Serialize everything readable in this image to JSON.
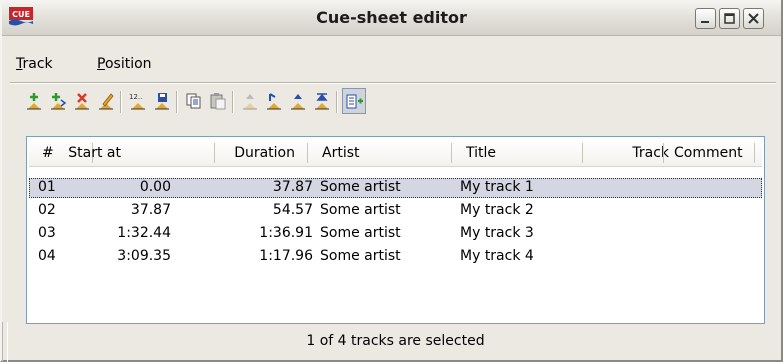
{
  "window": {
    "title": "Cue-sheet editor",
    "app_icon": "cue-logo",
    "app_icon_text": "CUE",
    "controls": [
      "minimize-icon",
      "maximize-icon",
      "close-icon"
    ]
  },
  "menu": {
    "track": {
      "accel": "T",
      "rest": "rack"
    },
    "position": {
      "accel": "P",
      "rest": "osition"
    }
  },
  "toolbar": {
    "buttons": [
      {
        "icon": "add-track-icon"
      },
      {
        "icon": "insert-track-icon"
      },
      {
        "icon": "delete-track-icon"
      },
      {
        "icon": "edit-track-icon"
      },
      {
        "icon": "renumber-tracks-icon",
        "text": "12.."
      },
      {
        "icon": "save-icon"
      },
      {
        "icon": "copy-icon"
      },
      {
        "icon": "paste-icon"
      },
      {
        "icon": "move-up-icon"
      },
      {
        "icon": "move-start-icon"
      },
      {
        "icon": "move-forward-icon"
      },
      {
        "icon": "move-end-icon"
      },
      {
        "icon": "toggle-panel-icon"
      }
    ]
  },
  "table": {
    "columns": [
      "#",
      "Start at",
      "Duration",
      "Artist",
      "Title",
      "Track",
      "Comment"
    ],
    "rows": [
      {
        "num": "01",
        "start": "0.00",
        "duration": "37.87",
        "artist": "Some artist",
        "title": "My track 1",
        "track": "",
        "comment": "",
        "selected": true
      },
      {
        "num": "02",
        "start": "37.87",
        "duration": "54.57",
        "artist": "Some artist",
        "title": "My track 2",
        "track": "",
        "comment": "",
        "selected": false
      },
      {
        "num": "03",
        "start": "1:32.44",
        "duration": "1:36.91",
        "artist": "Some artist",
        "title": "My track 3",
        "track": "",
        "comment": "",
        "selected": false
      },
      {
        "num": "04",
        "start": "3:09.35",
        "duration": "1:17.96",
        "artist": "Some artist",
        "title": "My track 4",
        "track": "",
        "comment": "",
        "selected": false
      }
    ]
  },
  "status": {
    "text": "1 of 4 tracks are selected"
  },
  "colors": {
    "selection": "#d4d7e2",
    "add_green": "#2e9a2e",
    "delete_red": "#d83a2a",
    "save_blue": "#2a4fa8",
    "accent_yellow": "#e2a72c"
  }
}
